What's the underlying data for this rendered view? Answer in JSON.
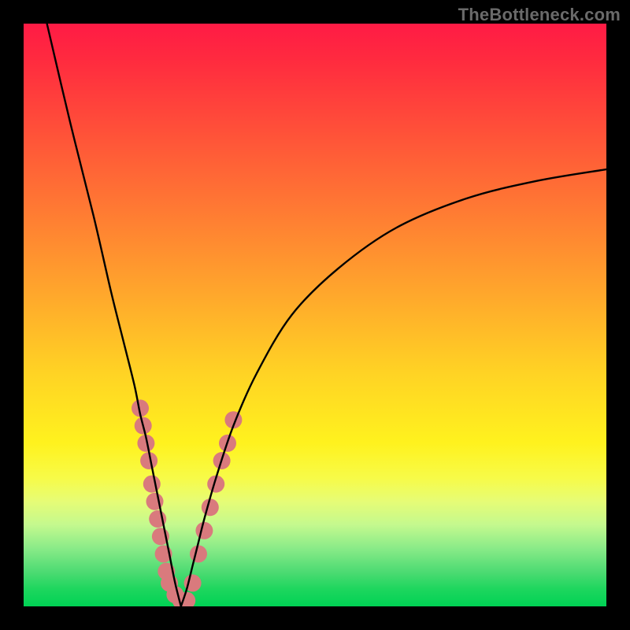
{
  "watermark": "TheBottleneck.com",
  "chart_data": {
    "type": "line",
    "title": "",
    "xlabel": "",
    "ylabel": "",
    "xlim": [
      0,
      100
    ],
    "ylim": [
      0,
      100
    ],
    "notes": "Two-branch V-shaped curve over red-to-green vertical gradient. Y-axis encodes severity (top = bad/red, bottom = good/green). Curve minimum ~x≈27 where both branches touch y≈0. Salmon-pink markers cluster on both branches near the trough.",
    "series": [
      {
        "name": "left-branch",
        "x": [
          4,
          8,
          12,
          15,
          17,
          19,
          20,
          21,
          22,
          23,
          24,
          25,
          26,
          27
        ],
        "y": [
          100,
          83,
          67,
          54,
          46,
          38,
          33,
          29,
          24,
          19,
          14,
          9,
          4,
          0
        ]
      },
      {
        "name": "right-branch",
        "x": [
          27,
          28,
          29,
          30,
          31,
          33,
          36,
          40,
          46,
          54,
          64,
          76,
          88,
          100
        ],
        "y": [
          0,
          3,
          7,
          11,
          15,
          22,
          31,
          40,
          50,
          58,
          65,
          70,
          73,
          75
        ]
      }
    ],
    "markers": {
      "color": "#d97a7d",
      "radius_px": 11,
      "left_branch_points": [
        [
          20,
          34
        ],
        [
          20.5,
          31
        ],
        [
          21,
          28
        ],
        [
          21.5,
          25
        ],
        [
          22,
          21
        ],
        [
          22.5,
          18
        ],
        [
          23,
          15
        ],
        [
          23.5,
          12
        ],
        [
          24,
          9
        ],
        [
          24.5,
          6
        ],
        [
          25,
          4
        ],
        [
          26,
          2
        ],
        [
          27,
          1
        ],
        [
          28,
          1
        ]
      ],
      "right_branch_points": [
        [
          29,
          4
        ],
        [
          30,
          9
        ],
        [
          31,
          13
        ],
        [
          32,
          17
        ],
        [
          33,
          21
        ],
        [
          34,
          25
        ],
        [
          35,
          28
        ],
        [
          36,
          32
        ]
      ]
    },
    "background_gradient": {
      "direction": "top-to-bottom",
      "stops": [
        {
          "pos": 0.0,
          "color": "#ff1b45"
        },
        {
          "pos": 0.18,
          "color": "#ff4f39"
        },
        {
          "pos": 0.46,
          "color": "#ffa62c"
        },
        {
          "pos": 0.72,
          "color": "#fff21e"
        },
        {
          "pos": 0.9,
          "color": "#8aeb88"
        },
        {
          "pos": 1.0,
          "color": "#00d254"
        }
      ]
    }
  }
}
